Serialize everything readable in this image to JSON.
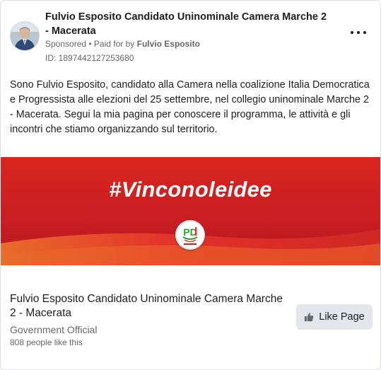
{
  "ad": {
    "page_name": "Fulvio Esposito Candidato Uninominale Camera Marche 2 - Macerata",
    "sponsored_label": "Sponsored",
    "separator": " • ",
    "paid_for_prefix": "Paid for by ",
    "paid_for_name": "Fulvio Esposito",
    "ad_id": "ID: 1897442127253680",
    "more_icon": "more-options-icon",
    "body_text": "Sono Fulvio Esposito, candidato alla Camera nella coalizione Italia Democratica e Progressista alle elezioni del 25 settembre, nel collegio uninominale Marche 2 - Macerata. Segui la mia pagina per conoscere il programma, le attività e gli incontri che stiamo organizzando sul territorio."
  },
  "banner": {
    "hashtag": "#Vinconoleidee",
    "logo_text": "PD",
    "colors": {
      "red_main": "#c81d22",
      "red_light": "#e8362b",
      "orange": "#ee6a2a",
      "green": "#2f9e3e"
    }
  },
  "footer": {
    "title": "Fulvio Esposito Candidato Uninominale Camera Marche 2 - Macerata",
    "category": "Government Official",
    "likes": "808 people like this",
    "like_button_label": "Like Page",
    "like_icon": "thumbs-up-icon"
  }
}
